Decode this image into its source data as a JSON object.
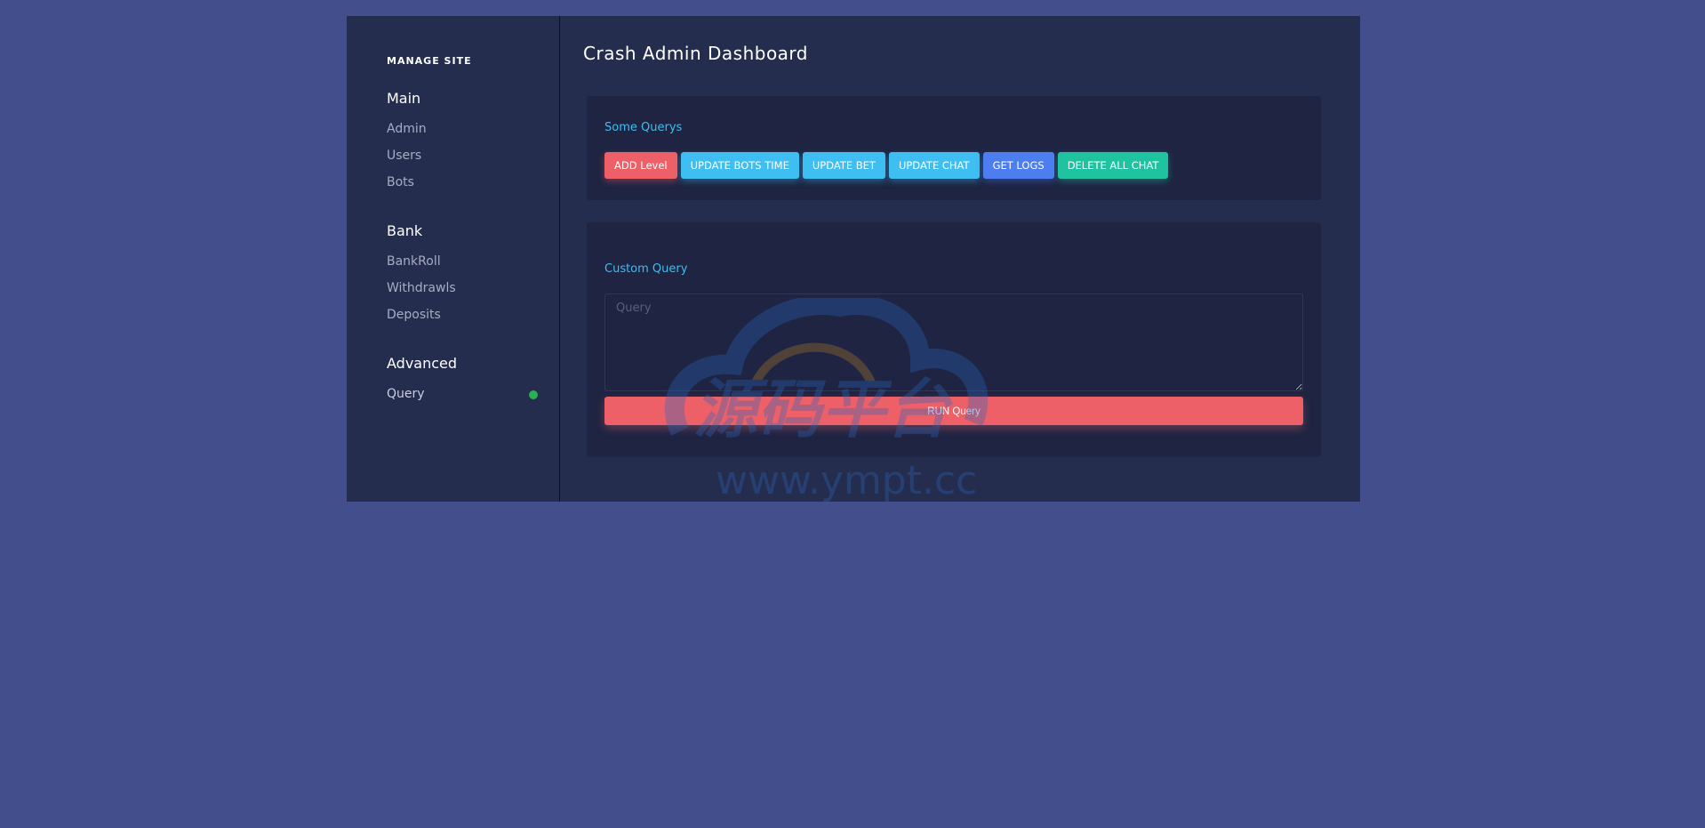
{
  "sidebar": {
    "manage_title": "MANAGE SITE",
    "groups": [
      {
        "heading": "Main",
        "items": [
          {
            "label": "Admin"
          },
          {
            "label": "Users"
          },
          {
            "label": "Bots"
          }
        ]
      },
      {
        "heading": "Bank",
        "items": [
          {
            "label": "BankRoll"
          },
          {
            "label": "Withdrawls"
          },
          {
            "label": "Deposits"
          }
        ]
      },
      {
        "heading": "Advanced",
        "items": [
          {
            "label": "Query",
            "status_color": "#2ab04d"
          }
        ]
      }
    ]
  },
  "main": {
    "title": "Crash Admin Dashboard",
    "some_queries": {
      "label": "Some Querys",
      "buttons": [
        {
          "label": "ADD Level",
          "color": "#ee6068"
        },
        {
          "label": "UPDATE BOTS TIME",
          "color": "#3fbef2"
        },
        {
          "label": "UPDATE BET",
          "color": "#3fbef2"
        },
        {
          "label": "UPDATE CHAT",
          "color": "#3fbef2"
        },
        {
          "label": "GET LOGS",
          "color": "#4c7ef0"
        },
        {
          "label": "DELETE ALL CHAT",
          "color": "#1fc3a0"
        }
      ]
    },
    "custom_query": {
      "label": "Custom Query",
      "placeholder": "Query",
      "value": "",
      "run_label": "RUN Query",
      "run_color": "#ee6068"
    }
  },
  "watermark": {
    "text_cn": "源码平台",
    "text_url": "www.ympt.cc"
  },
  "colors": {
    "page_bg": "#434f8c",
    "panel_bg": "#252d4f",
    "card_bg": "#1e2442",
    "accent": "#3fbef2"
  }
}
